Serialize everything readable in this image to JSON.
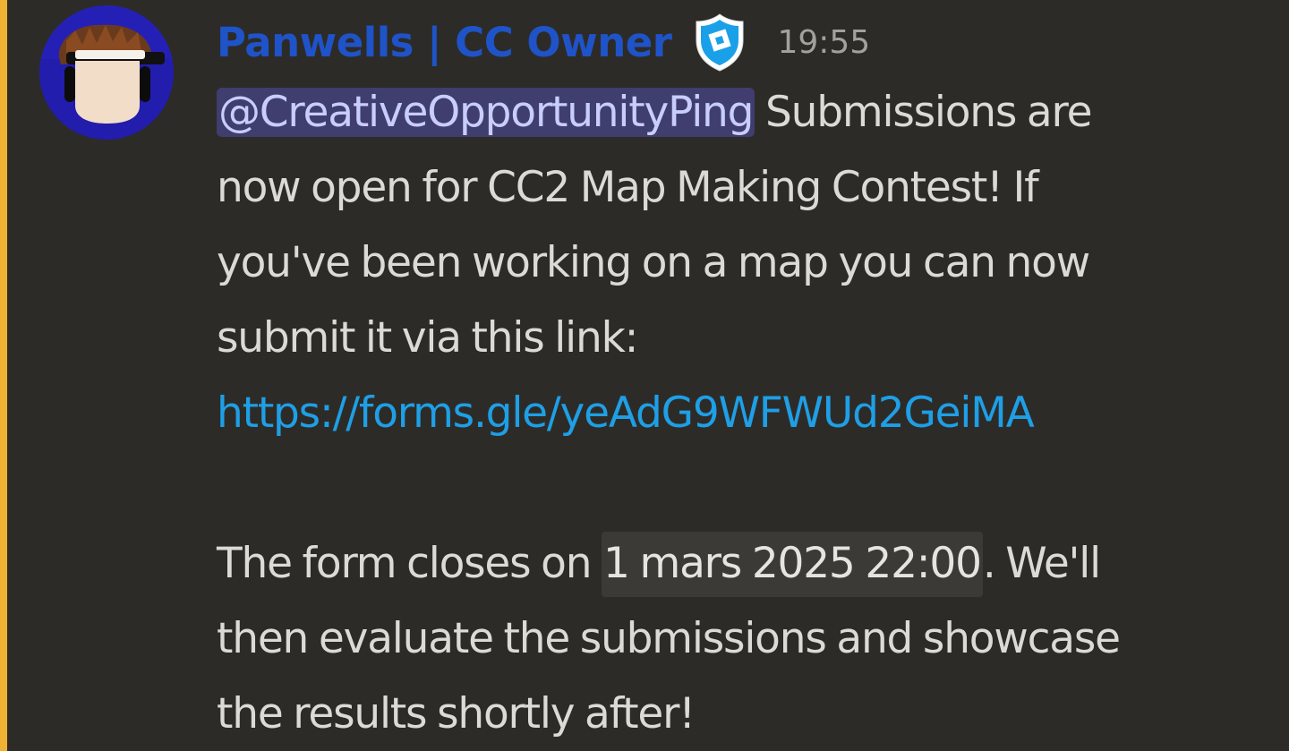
{
  "message": {
    "author": "Panwells | CC Owner",
    "role_icon": "shield-icon",
    "timestamp": "19:55",
    "mention": "@CreativeOpportunityPing",
    "text_1": " Submissions are",
    "text_2": "now open for CC2 Map Making Contest! If",
    "text_3": "you've been working on a map you can now",
    "text_4": "submit it via this link:",
    "link": "https://forms.gle/yeAdG9WFWUd2GeiMA",
    "text_5": "The form closes on ",
    "date": "1 mars 2025 22:00",
    "text_6": ". We'll",
    "text_7": "then evaluate the submissions and showcase",
    "text_8": "the results shortly after!"
  },
  "colors": {
    "background": "#2d2b28",
    "accent_bar": "#f0b232",
    "username": "#1f53c8",
    "mention_bg": "#3f3e6e",
    "mention_text": "#c9cdfb",
    "link": "#1e9fe6",
    "timestamp": "#a3a19d",
    "text": "#dcdad6"
  }
}
